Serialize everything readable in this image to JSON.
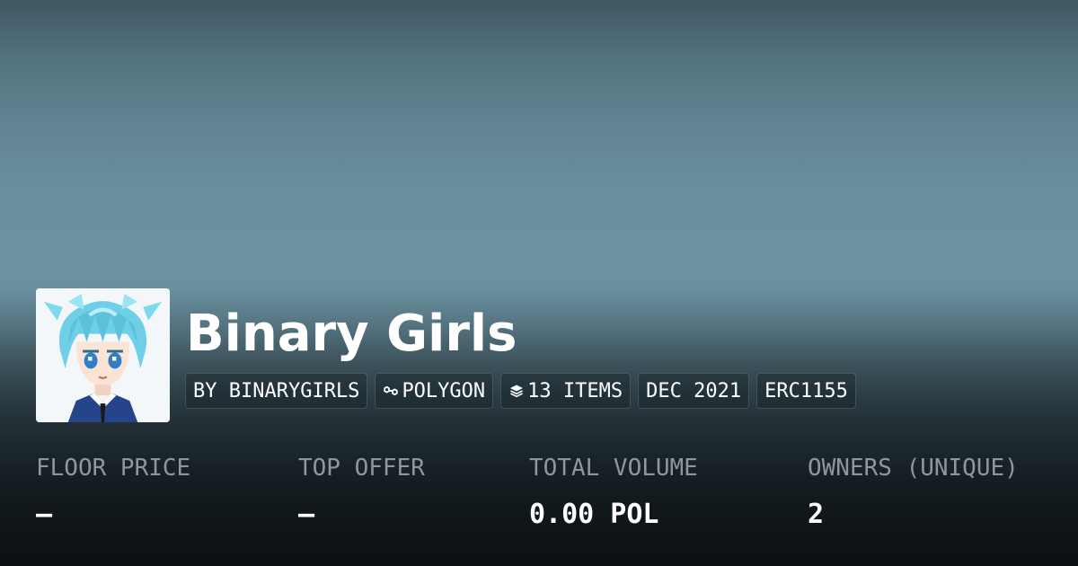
{
  "collection": {
    "name": "Binary Girls",
    "avatar_icon": "anime-character-avatar"
  },
  "chips": [
    {
      "label": "BY BINARYGIRLS",
      "icon": ""
    },
    {
      "label": "POLYGON",
      "icon": "polygon-chain-icon"
    },
    {
      "label": "13 ITEMS",
      "icon": "layers-stack-icon"
    },
    {
      "label": "DEC 2021",
      "icon": ""
    },
    {
      "label": "ERC1155",
      "icon": ""
    }
  ],
  "stats": [
    {
      "label": "FLOOR PRICE",
      "value": "—"
    },
    {
      "label": "TOP OFFER",
      "value": "—"
    },
    {
      "label": "TOTAL VOLUME",
      "value": "0.00 POL"
    },
    {
      "label": "OWNERS (UNIQUE)",
      "value": "2"
    }
  ],
  "colors": {
    "text_primary": "#ffffff",
    "text_muted": "#8d979c",
    "background_top": "#6c93a2",
    "background_bottom": "#0b1013"
  }
}
